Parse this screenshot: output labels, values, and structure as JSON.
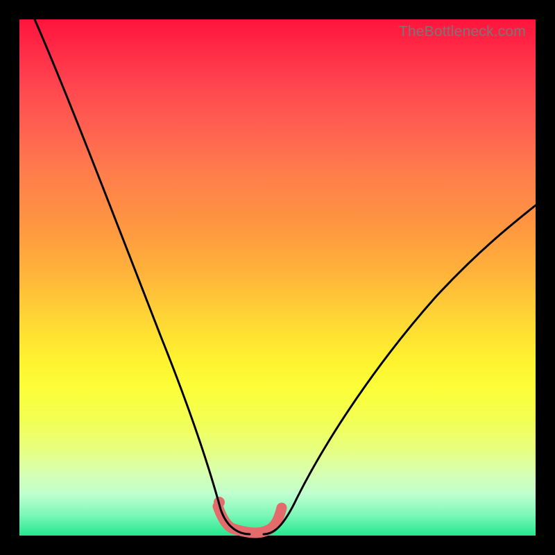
{
  "watermark": "TheBottleneck.com",
  "colors": {
    "page_bg": "#000000",
    "curve_stroke": "#000000",
    "bump_stroke": "#e46b6b",
    "gradient_stops": [
      "#ff143c",
      "#ff2f49",
      "#ff4a4f",
      "#ff6450",
      "#ff7e4c",
      "#ff9640",
      "#ffb63a",
      "#ffd635",
      "#fff22f",
      "#fbff3a",
      "#f2ff55",
      "#e8ff7d",
      "#d7ffb2",
      "#bfffd0",
      "#7cf7b7",
      "#23e88e"
    ]
  },
  "chart_data": {
    "type": "line",
    "title": "",
    "xlabel": "",
    "ylabel": "",
    "xlim": [
      0,
      100
    ],
    "ylim": [
      0,
      100
    ],
    "grid": false,
    "series": [
      {
        "name": "left-descent",
        "x": [
          3,
          8,
          13,
          18,
          23,
          28,
          33,
          36.5,
          38.5
        ],
        "y": [
          100,
          88,
          75,
          62,
          48,
          34,
          20,
          9,
          2
        ]
      },
      {
        "name": "valley",
        "x": [
          38.5,
          40,
          42,
          44,
          46,
          48,
          49.5
        ],
        "y": [
          2,
          0.5,
          0,
          0,
          0,
          0.5,
          2
        ]
      },
      {
        "name": "right-ascent",
        "x": [
          49.5,
          55,
          62,
          70,
          80,
          90,
          100
        ],
        "y": [
          2,
          8,
          17,
          28,
          41,
          54,
          64
        ]
      }
    ],
    "markers": {
      "name": "valley-bumps",
      "x": [
        38.5,
        40,
        42,
        44,
        46,
        48,
        49.5
      ],
      "y": [
        4,
        1.5,
        0.5,
        0.5,
        0.5,
        1.5,
        4
      ]
    }
  }
}
